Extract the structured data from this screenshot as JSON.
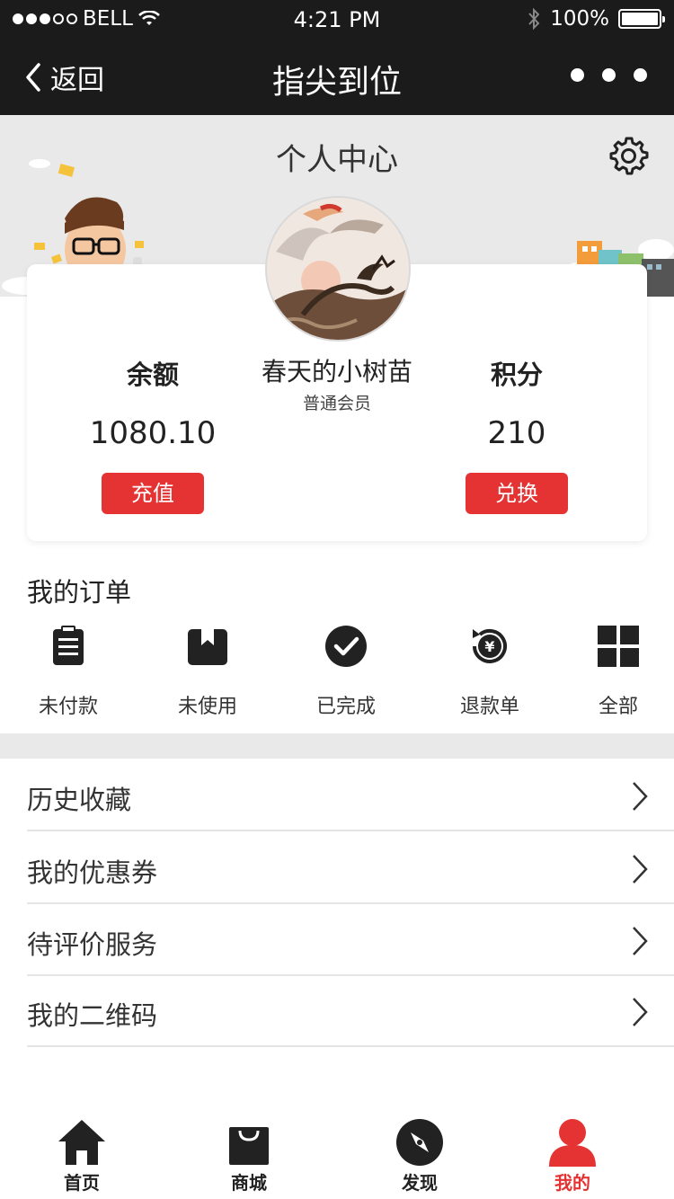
{
  "status_bar": {
    "carrier": "BELL",
    "time": "4:21 PM",
    "battery": "100%"
  },
  "nav": {
    "back_label": "返回",
    "title": "指尖到位"
  },
  "header": {
    "title": "个人中心"
  },
  "profile": {
    "name": "春天的小树苗",
    "level": "普通会员",
    "balance_label": "余额",
    "balance_value": "1080.10",
    "recharge_button": "充值",
    "points_label": "积分",
    "points_value": "210",
    "redeem_button": "兑换"
  },
  "orders": {
    "title": "我的订单",
    "items": [
      {
        "label": "未付款",
        "icon": "clipboard-icon"
      },
      {
        "label": "未使用",
        "icon": "ticket-box-icon"
      },
      {
        "label": "已完成",
        "icon": "check-circle-icon"
      },
      {
        "label": "退款单",
        "icon": "refund-icon"
      },
      {
        "label": "全部",
        "icon": "grid-icon"
      }
    ]
  },
  "menu": {
    "items": [
      {
        "label": "历史收藏"
      },
      {
        "label": "我的优惠券"
      },
      {
        "label": "待评价服务"
      },
      {
        "label": "我的二维码"
      }
    ]
  },
  "tabbar": {
    "items": [
      {
        "label": "首页",
        "icon": "home-icon"
      },
      {
        "label": "商城",
        "icon": "shopping-bag-icon"
      },
      {
        "label": "发现",
        "icon": "compass-icon"
      },
      {
        "label": "我的",
        "icon": "user-icon"
      }
    ],
    "active_color": "#e53333"
  },
  "colors": {
    "accent": "#e53333",
    "nav_bg": "#1b1b1b",
    "banner_bg": "#e9e9e9"
  }
}
